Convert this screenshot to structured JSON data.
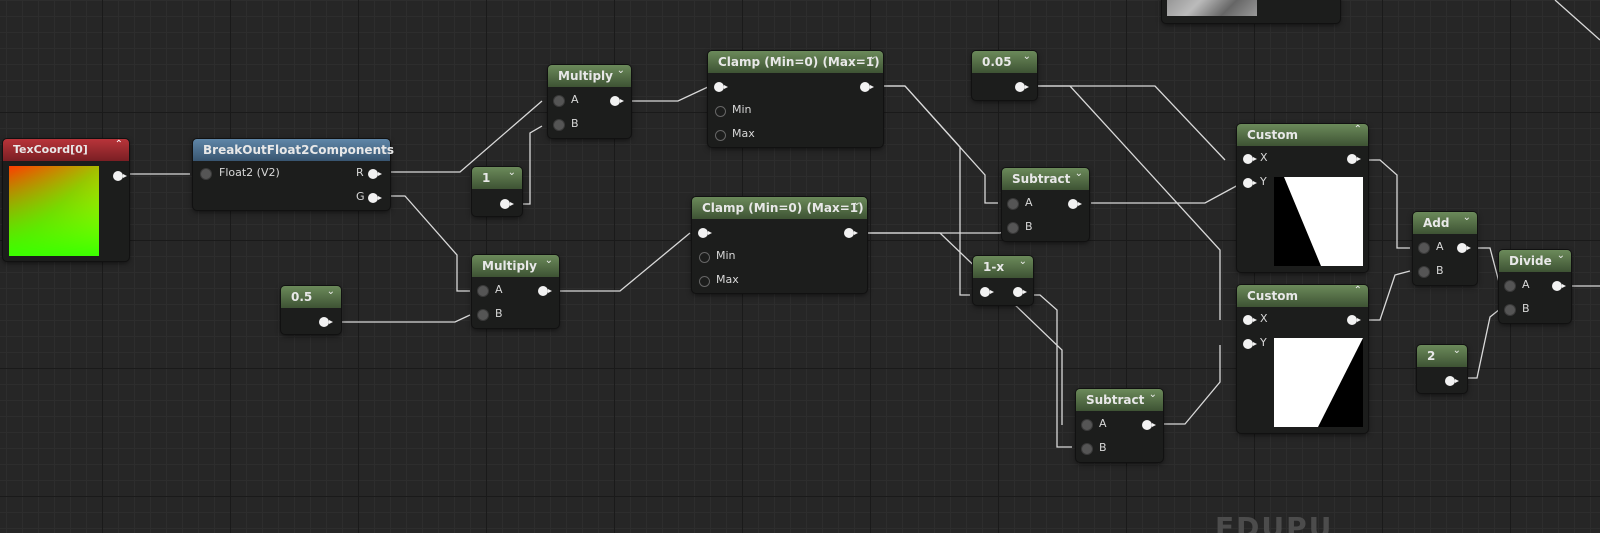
{
  "watermark": "EDUPU",
  "nodes": {
    "texcoord": {
      "title": "TexCoord[0]"
    },
    "breakout": {
      "title": "BreakOutFloat2Components",
      "in": "Float2 (V2)",
      "out_r": "R",
      "out_g": "G"
    },
    "const1": {
      "value": "1"
    },
    "const05": {
      "value": "0.5"
    },
    "multiply1": {
      "title": "Multiply",
      "a": "A",
      "b": "B"
    },
    "multiply2": {
      "title": "Multiply",
      "a": "A",
      "b": "B"
    },
    "clamp1": {
      "title": "Clamp (Min=0) (Max=1)",
      "min": "Min",
      "max": "Max"
    },
    "clamp2": {
      "title": "Clamp (Min=0) (Max=1)",
      "min": "Min",
      "max": "Max"
    },
    "const005": {
      "value": "0.05"
    },
    "subtract1": {
      "title": "Subtract",
      "a": "A",
      "b": "B"
    },
    "oneminusx": {
      "title": "1-x"
    },
    "subtract2": {
      "title": "Subtract",
      "a": "A",
      "b": "B"
    },
    "custom1": {
      "title": "Custom",
      "x": "X",
      "y": "Y"
    },
    "custom2": {
      "title": "Custom",
      "x": "X",
      "y": "Y"
    },
    "add": {
      "title": "Add",
      "a": "A",
      "b": "B"
    },
    "divide": {
      "title": "Divide",
      "a": "A",
      "b": "B"
    },
    "const2": {
      "value": "2"
    }
  },
  "colors": {
    "wire": "#d9d9d9",
    "header_green": "#587a48",
    "header_blue": "#4a6f8f",
    "header_red": "#a02c31",
    "canvas": "#262626"
  }
}
